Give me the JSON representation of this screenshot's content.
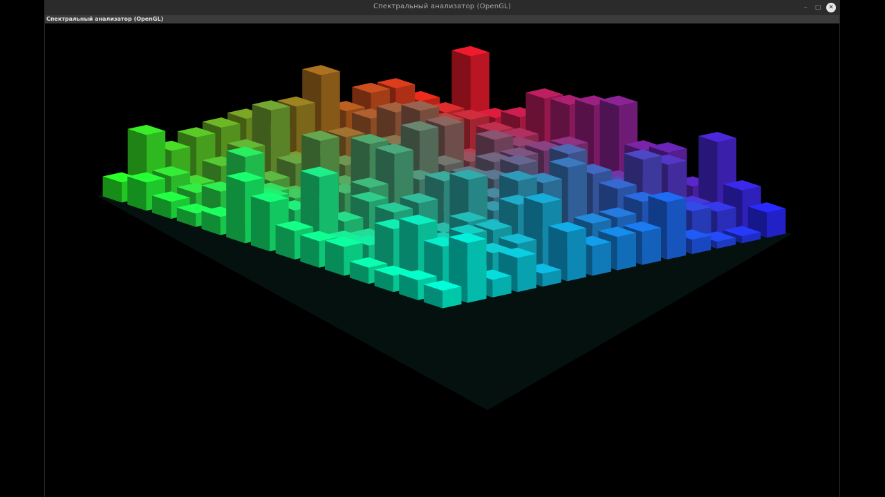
{
  "window": {
    "title": "Спектральный анализатор (OpenGL)",
    "minimize_glyph": "–",
    "maximize_glyph": "□",
    "close_glyph": "✕"
  },
  "app": {
    "label": "Спектральный анализатор (OpenGL)"
  },
  "visualization": {
    "background": "#000000",
    "corner_colors": {
      "back": "#ff1a1a",
      "left": "#2aff2a",
      "front": "#00ffd8",
      "right": "#2a2aff"
    },
    "grid_rows": 14,
    "grid_cols": 14
  }
}
